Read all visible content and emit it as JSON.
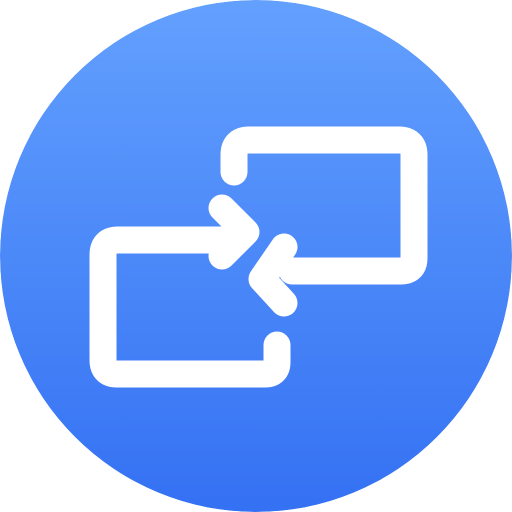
{
  "icon": {
    "name": "switch-screens-icon",
    "colors": {
      "circle_top": "#63A0FE",
      "circle_bottom": "#3471F3",
      "glyph": "#FFFFFF"
    }
  }
}
